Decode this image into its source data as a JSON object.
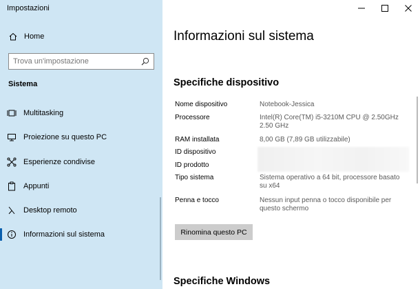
{
  "app": {
    "title": "Impostazioni"
  },
  "sidebar": {
    "home_label": "Home",
    "search_placeholder": "Trova un'impostazione",
    "section_title": "Sistema",
    "items": [
      {
        "label": "Multitasking",
        "icon": "multitasking-icon"
      },
      {
        "label": "Proiezione su questo PC",
        "icon": "projection-icon"
      },
      {
        "label": "Esperienze condivise",
        "icon": "shared-experiences-icon"
      },
      {
        "label": "Appunti",
        "icon": "clipboard-icon"
      },
      {
        "label": "Desktop remoto",
        "icon": "remote-desktop-icon"
      },
      {
        "label": "Informazioni sul sistema",
        "icon": "info-icon",
        "active": true
      }
    ]
  },
  "main": {
    "title": "Informazioni sul sistema",
    "device_specs": {
      "heading": "Specifiche dispositivo",
      "rows": [
        {
          "label": "Nome dispositivo",
          "value": "Notebook-Jessica"
        },
        {
          "label": "Processore",
          "value": "Intel(R) Core(TM) i5-3210M CPU @ 2.50GHz 2.50 GHz"
        },
        {
          "label": "RAM installata",
          "value": "8,00 GB (7,89 GB utilizzabile)"
        },
        {
          "label": "ID dispositivo",
          "value": ""
        },
        {
          "label": "ID prodotto",
          "value": ""
        },
        {
          "label": "Tipo sistema",
          "value": "Sistema operativo a 64 bit, processore basato su x64"
        },
        {
          "label": "Penna e tocco",
          "value": "Nessun input penna o tocco disponibile per questo schermo"
        }
      ],
      "rename_button": "Rinomina questo PC"
    },
    "windows_specs": {
      "heading": "Specifiche Windows"
    }
  },
  "colors": {
    "sidebar_bg": "#cfe6f4",
    "accent": "#0a5fad",
    "button_bg": "#cccccc"
  }
}
